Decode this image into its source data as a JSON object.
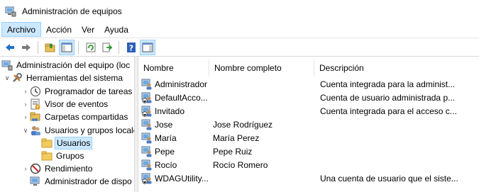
{
  "window": {
    "title": "Administración de equipos"
  },
  "menu": [
    {
      "label": "Archivo",
      "active": true
    },
    {
      "label": "Acción",
      "active": false
    },
    {
      "label": "Ver",
      "active": false
    },
    {
      "label": "Ayuda",
      "active": false
    }
  ],
  "toolbar": {
    "buttons": [
      "back-arrow-icon",
      "forward-arrow-icon",
      "up-folder-icon",
      "show-hide-tree-icon",
      "refresh-icon",
      "export-list-icon",
      "help-icon",
      "action-pane-icon"
    ]
  },
  "tree": {
    "items": [
      {
        "label": "Administración del equipo (loc",
        "icon": "computer-management-icon",
        "level": 0,
        "twisty": ""
      },
      {
        "label": "Herramientas del sistema",
        "icon": "system-tools-icon",
        "level": 1,
        "twisty": "expanded"
      },
      {
        "label": "Programador de tareas",
        "icon": "task-scheduler-icon",
        "level": 2,
        "twisty": "collapsed"
      },
      {
        "label": "Visor de eventos",
        "icon": "event-viewer-icon",
        "level": 2,
        "twisty": "collapsed"
      },
      {
        "label": "Carpetas compartidas",
        "icon": "shared-folders-icon",
        "level": 2,
        "twisty": "collapsed"
      },
      {
        "label": "Usuarios y grupos locale",
        "icon": "users-groups-icon",
        "level": 2,
        "twisty": "expanded"
      },
      {
        "label": "Usuarios",
        "icon": "folder-icon",
        "level": 3,
        "twisty": "",
        "selected": true
      },
      {
        "label": "Grupos",
        "icon": "folder-icon",
        "level": 3,
        "twisty": ""
      },
      {
        "label": "Rendimiento",
        "icon": "performance-icon",
        "level": 2,
        "twisty": "collapsed"
      },
      {
        "label": "Administrador de dispo",
        "icon": "device-manager-icon",
        "level": 2,
        "twisty": ""
      }
    ]
  },
  "list": {
    "columns": [
      "Nombre",
      "Nombre completo",
      "Descripción"
    ],
    "rows": [
      {
        "name": "Administrador",
        "fullname": "",
        "description": "Cuenta integrada para la administ...",
        "disabled": false
      },
      {
        "name": "DefaultAcco...",
        "fullname": "",
        "description": "Cuenta de usuario administrada p...",
        "disabled": true
      },
      {
        "name": "Invitado",
        "fullname": "",
        "description": "Cuenta integrada para el acceso c...",
        "disabled": true
      },
      {
        "name": "Jose",
        "fullname": "Jose Rodríguez",
        "description": "",
        "disabled": false
      },
      {
        "name": "María",
        "fullname": "María Perez",
        "description": "",
        "disabled": false
      },
      {
        "name": "Pepe",
        "fullname": "Pepe Ruiz",
        "description": "",
        "disabled": false
      },
      {
        "name": "Rocío",
        "fullname": "Rocío Romero",
        "description": "",
        "disabled": false
      },
      {
        "name": "WDAGUtility...",
        "fullname": "",
        "description": "Una cuenta de usuario que el siste...",
        "disabled": true
      }
    ]
  },
  "colors": {
    "selection": "#cce8ff",
    "selection_border": "#99d1ff",
    "toolbar_blue": "#1e6fc8"
  }
}
